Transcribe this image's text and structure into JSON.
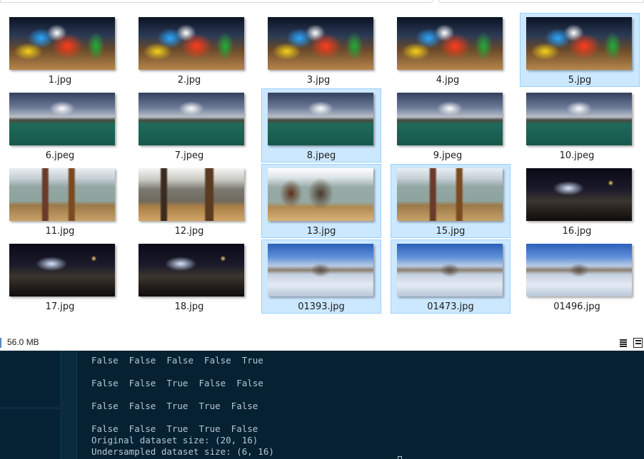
{
  "files": [
    {
      "name": "1.jpg",
      "type": "christmas",
      "selected": false
    },
    {
      "name": "2.jpg",
      "type": "christmas",
      "selected": false
    },
    {
      "name": "3.jpg",
      "type": "christmas",
      "selected": false
    },
    {
      "name": "4.jpg",
      "type": "christmas",
      "selected": false
    },
    {
      "name": "5.jpg",
      "type": "christmas",
      "selected": true
    },
    {
      "name": "6.jpeg",
      "type": "sea",
      "selected": false
    },
    {
      "name": "7.jpeg",
      "type": "sea",
      "selected": false
    },
    {
      "name": "8.jpeg",
      "type": "sea",
      "selected": true
    },
    {
      "name": "9.jpeg",
      "type": "sea",
      "selected": false
    },
    {
      "name": "10.jpeg",
      "type": "sea",
      "selected": false
    },
    {
      "name": "11.jpg",
      "type": "gallery-a",
      "selected": false
    },
    {
      "name": "12.jpg",
      "type": "gallery-b",
      "selected": false
    },
    {
      "name": "13.jpg",
      "type": "gallery-c",
      "selected": true
    },
    {
      "name": "15.jpg",
      "type": "gallery-a",
      "selected": true
    },
    {
      "name": "16.jpg",
      "type": "night",
      "selected": false
    },
    {
      "name": "17.jpg",
      "type": "night",
      "selected": false
    },
    {
      "name": "18.jpg",
      "type": "night",
      "selected": false
    },
    {
      "name": "01393.jpg",
      "type": "snow",
      "selected": true
    },
    {
      "name": "01473.jpg",
      "type": "snow",
      "selected": true
    },
    {
      "name": "01496.jpg",
      "type": "snow",
      "selected": false
    }
  ],
  "statusbar": {
    "size": "56.0 MB",
    "details_view_icon": "details-view-icon",
    "large_icons_view_icon": "large-icons-view-icon"
  },
  "terminal": {
    "lines": [
      "False  False  False  False  True",
      "",
      "False  False  True  False  False",
      "",
      "False  False  True  True  False",
      "",
      "False  False  True  True  False",
      "Original dataset size: (20, 16)",
      "Undersampled dataset size: (6, 16)"
    ]
  },
  "colors": {
    "selection_bg": "#cce8ff",
    "selection_border": "#99d1ff",
    "terminal_bg": "#052132",
    "terminal_text": "#b7c7d2"
  }
}
